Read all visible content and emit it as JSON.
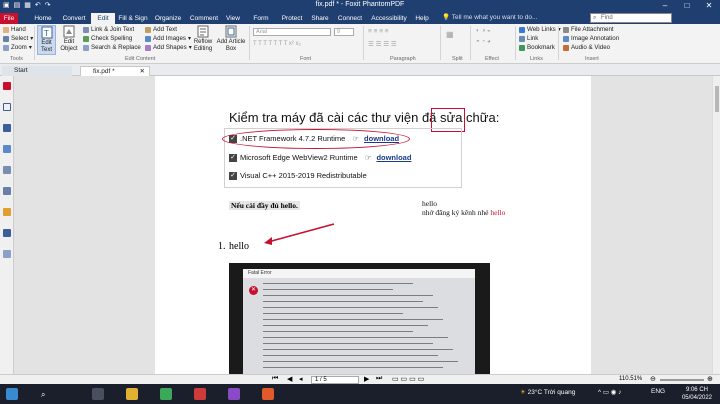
{
  "window": {
    "title": "fix.pdf * - Foxit PhantomPDF",
    "controls": [
      "–",
      "□",
      "✕"
    ]
  },
  "tabs": {
    "file": "File",
    "items": [
      "Home",
      "Convert",
      "Edit",
      "Fill & Sign",
      "Organize",
      "Comment",
      "View",
      "Form",
      "Protect",
      "Share",
      "Connect",
      "Accessibility",
      "Help"
    ],
    "tell_me": "Tell me what you want to do...",
    "find_placeholder": "Find"
  },
  "ribbon": {
    "tools": {
      "hand": "Hand",
      "select": "Select",
      "zoom": "Zoom",
      "label": "Tools"
    },
    "edit_content": {
      "edit_text": "Edit Text",
      "edit_object": "Edit Object",
      "link_join": "Link & Join Text",
      "check_spelling": "Check Spelling",
      "search_replace": "Search & Replace",
      "add_text": "Add Text",
      "add_images": "Add Images",
      "add_shapes": "Add Shapes",
      "reflow": "Reflow Editing",
      "add_article": "Add Article Box",
      "label": "Edit Content"
    },
    "font": {
      "name": "Arial",
      "size": "9",
      "label": "Font"
    },
    "paragraph": {
      "label": "Paragraph"
    },
    "split": {
      "label": "Split"
    },
    "effect": {
      "label": "Effect"
    },
    "links": {
      "web_links": "Web Links",
      "link": "Link",
      "bookmark": "Bookmark",
      "label": "Links"
    },
    "insert": {
      "file_attachment": "File Attachment",
      "image_annotation": "Image Annotation",
      "audio_video": "Audio & Video",
      "label": "Insert"
    }
  },
  "doc_tabs": [
    "Start",
    "fix.pdf *"
  ],
  "document": {
    "heading": "Kiểm tra máy đã cài các thư viện đã sửa chữa:",
    "options": [
      {
        "label": ".NET Framework 4.7.2 Runtime",
        "link": "download"
      },
      {
        "label": "Microsoft Edge WebView2 Runtime",
        "link": "download"
      },
      {
        "label": "Visual C++ 2015-2019 Redistributable",
        "link": ""
      }
    ],
    "note": "Nếu cài đầy đủ hello.",
    "comment_line1": "hello",
    "comment_line2_prefix": "nhớ đăng ký kênh nhé ",
    "comment_line2_red": "hello",
    "list_number": "1.",
    "list_item": "hello",
    "embedded_title": "Fatal Error"
  },
  "statusbar": {
    "page": "1 / 5",
    "zoom": "110.51%"
  },
  "taskbar": {
    "weather": "23°C  Trời quang",
    "lang": "ENG",
    "time": "9:06 CH",
    "date": "05/04/2022"
  }
}
